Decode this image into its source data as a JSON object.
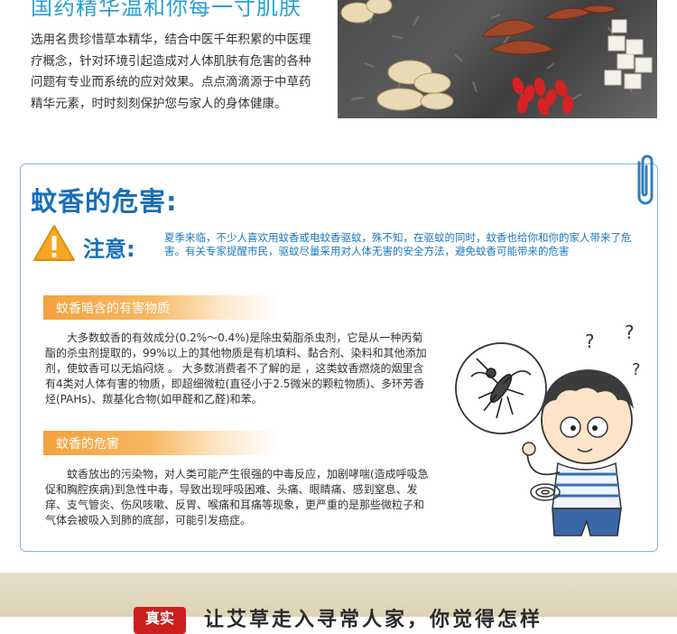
{
  "top": {
    "heading": "国药精华温和你每一寸肌肤",
    "paragraph": "选用名贵珍惜草本精华，结合中医千年积累的中医理疗概念，针对环境引起造成对人体肌肤有危害的各种问题有专业而系统的应对效果。点点滴滴源于中草药精华元素，时时刻刻保护您与家人的身体健康。"
  },
  "card": {
    "title": "蚊香的危害:",
    "notice_label": "注意:",
    "notice_text": "夏季来临，不少人喜欢用蚊香或电蚊香驱蚊，殊不知，在驱蚊的同时，蚊香也给你和你的家人带来了危害。有关专家提醒市民，驱蚊尽量采用对人体无害的安全方法，避免蚊香可能带来的危害",
    "section1_title": "蚊香暗含的有害物质",
    "section1_text": "大多数蚊香的有效成分(0.2%～0.4%)是除虫菊脂杀虫剂，它是从一种丙菊酯的杀虫剂提取的，99%以上的其他物质是有机填料、黏合剂、染料和其他添加剂，使蚊香可以无焰闷烧 。 大多数消费者不了解的是 ，这类蚊香燃烧的烟里含有4类对人体有害的物质，即超细微粒(直径小于2.5微米的颗粒物质)、多环芳香烃(PAHs)、羰基化合物(如甲醛和乙醛)和苯。",
    "section2_title": "蚊香的危害",
    "section2_text": "蚊香放出的污染物，对人类可能产生很强的中毒反应，加剧哮喘(造成呼吸急促和胸腔疾病)到急性中毒，导致出现呼吸困难、头痛、眼睛痛、感到窒息、发痒、支气管炎、伤风咳嗽、反胃、喉痛和耳痛等现象，更严重的是那些微粒子和气体会被吸入到肺的底部，可能引发癌症。"
  },
  "bottom": {
    "badge": "真实",
    "title": "让艾草走入寻常人家，你觉得怎样"
  },
  "colors": {
    "heading_blue": "#2aa0d4",
    "title_blue": "#1a6fb5",
    "banner_orange": "#f4a23c",
    "warning_yellow": "#f5a623",
    "card_border": "#7fb9d8",
    "badge_red": "#cc1f1f"
  },
  "icons": {
    "warning": "warning-triangle-icon",
    "clip": "paperclip-icon",
    "mosquito": "mosquito-icon"
  }
}
